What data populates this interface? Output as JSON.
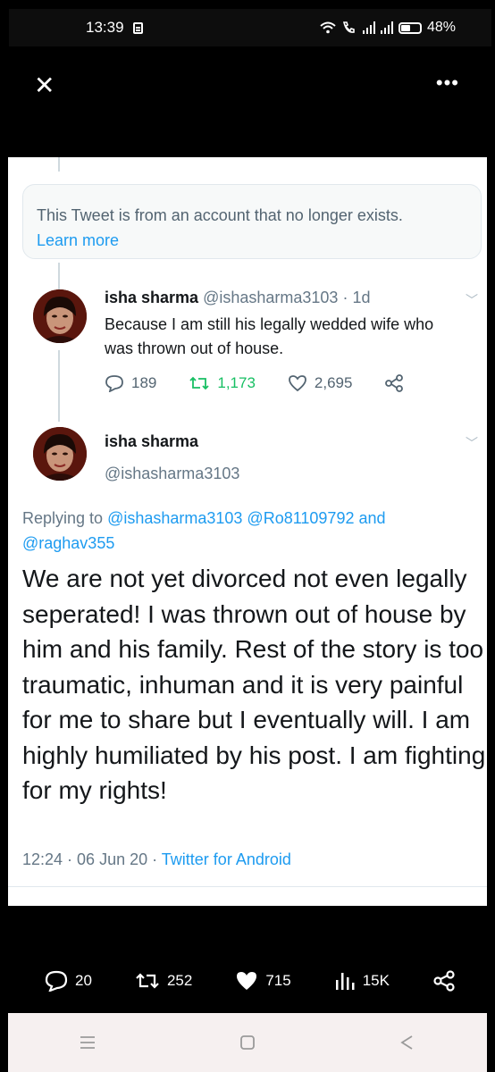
{
  "status_bar": {
    "time": "13:39",
    "battery": "48%"
  },
  "notice": {
    "text": "This Tweet is from an account that no longer exists.",
    "link": "Learn more"
  },
  "tweet1": {
    "name": "isha sharma",
    "handle": "@ishasharma3103",
    "age": "1d",
    "text": "Because I am still his legally wedded wife who was thrown out of house.",
    "replies": "189",
    "retweets": "1,173",
    "likes": "2,695"
  },
  "tweet2": {
    "name": "isha sharma",
    "handle": "@ishasharma3103",
    "replying_label": "Replying to",
    "replying_to": "@ishasharma3103 @Ro81109792 and @raghav355",
    "text": "We are not yet divorced not even legally seperated! I was thrown out of house by him and his family. Rest of the story is too traumatic, inhuman and it is very painful for me to share but I eventually will. I am highly humiliated by his post. I am fighting for my rights!",
    "time": "12:24 · 06 Jun 20 ·",
    "source": "Twitter for Android"
  },
  "bottom_bar": {
    "comments": "20",
    "retweets": "252",
    "likes": "715",
    "views": "15K"
  },
  "icons": [
    "wifi-icon",
    "call-icon",
    "signal-icon",
    "battery-icon",
    "close-icon",
    "more-icon",
    "reply-icon",
    "retweet-icon",
    "like-icon",
    "share-icon",
    "views-icon",
    "menu-icon",
    "home-icon",
    "back-icon",
    "chevron-down-icon"
  ]
}
